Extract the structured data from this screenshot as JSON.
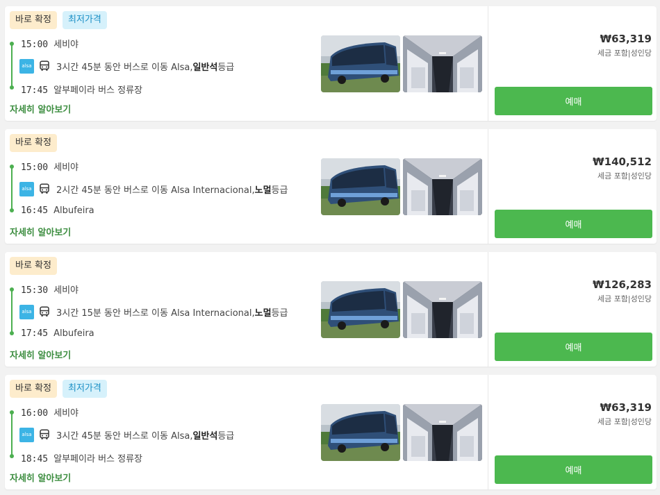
{
  "colors": {
    "accent_green": "#4cb84f",
    "confirm_badge_bg": "#fdeccc",
    "cheapest_badge_bg": "#d6f1fb",
    "operator_logo": "#3cb4e5"
  },
  "icons": {
    "bus": "bus-icon",
    "operator": "alsa-logo-icon"
  },
  "results": [
    {
      "badge_confirm": "바로 확정",
      "badge_cheapest": "최저가격",
      "dep_time": "15:00",
      "dep_place": "세비야",
      "info_pre": "3시간 45분 동안 버스로 이동 Alsa, ",
      "info_class": "일반석",
      "info_post": " 등급",
      "arr_time": "17:45",
      "arr_place": "알부페이라 버스 정류장",
      "more_link": "자세히 알아보기",
      "logo_text": "alsa",
      "price": "₩63,319",
      "price_note": "세금 포함|성인당",
      "book_label": "예매"
    },
    {
      "badge_confirm": "바로 확정",
      "badge_cheapest": "",
      "dep_time": "15:00",
      "dep_place": "세비야",
      "info_pre": "2시간 45분 동안 버스로 이동 Alsa Internacional, ",
      "info_class": "노멀",
      "info_post": " 등급",
      "arr_time": "16:45",
      "arr_place": "Albufeira",
      "more_link": "자세히 알아보기",
      "logo_text": "alsa",
      "price": "₩140,512",
      "price_note": "세금 포함|성인당",
      "book_label": "예매"
    },
    {
      "badge_confirm": "바로 확정",
      "badge_cheapest": "",
      "dep_time": "15:30",
      "dep_place": "세비야",
      "info_pre": "3시간 15분 동안 버스로 이동 Alsa Internacional, ",
      "info_class": "노멀",
      "info_post": " 등급",
      "arr_time": "17:45",
      "arr_place": "Albufeira",
      "more_link": "자세히 알아보기",
      "logo_text": "alsa",
      "price": "₩126,283",
      "price_note": "세금 포함|성인당",
      "book_label": "예매"
    },
    {
      "badge_confirm": "바로 확정",
      "badge_cheapest": "최저가격",
      "dep_time": "16:00",
      "dep_place": "세비야",
      "info_pre": "3시간 45분 동안 버스로 이동 Alsa, ",
      "info_class": "일반석",
      "info_post": " 등급",
      "arr_time": "18:45",
      "arr_place": "알부페이라 버스 정류장",
      "more_link": "자세히 알아보기",
      "logo_text": "alsa",
      "price": "₩63,319",
      "price_note": "세금 포함|성인당",
      "book_label": "예매"
    }
  ]
}
